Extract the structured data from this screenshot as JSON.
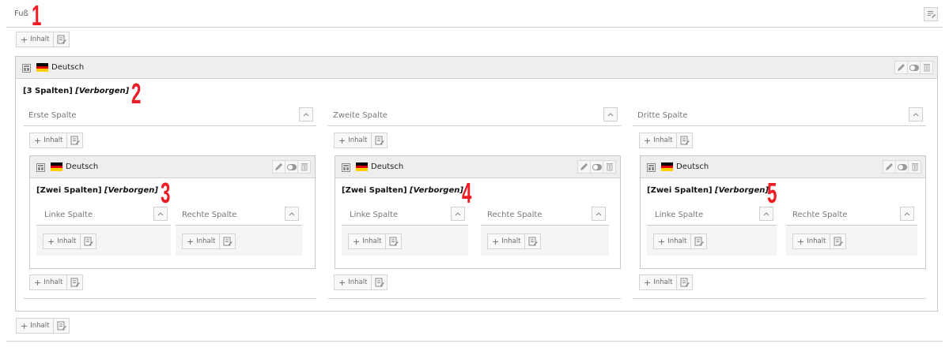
{
  "header": {
    "title": "Fuß"
  },
  "markers": [
    "1",
    "2",
    "3",
    "4",
    "5"
  ],
  "add_content": {
    "label": "Inhalt"
  },
  "outer_element": {
    "language": "Deutsch",
    "title": "[3 Spalten]",
    "hidden_label": "[Verborgen]",
    "columns": [
      "Erste Spalte",
      "Zweite Spalte",
      "Dritte Spalte"
    ]
  },
  "inner_element": {
    "language": "Deutsch",
    "title": "[Zwei Spalten]",
    "hidden_label": "[Verborgen]",
    "columns": [
      "Linke Spalte",
      "Rechte Spalte"
    ]
  },
  "colors": {
    "marker": "#ee1c25",
    "flag": [
      "#000000",
      "#dd0000",
      "#ffce00"
    ]
  }
}
